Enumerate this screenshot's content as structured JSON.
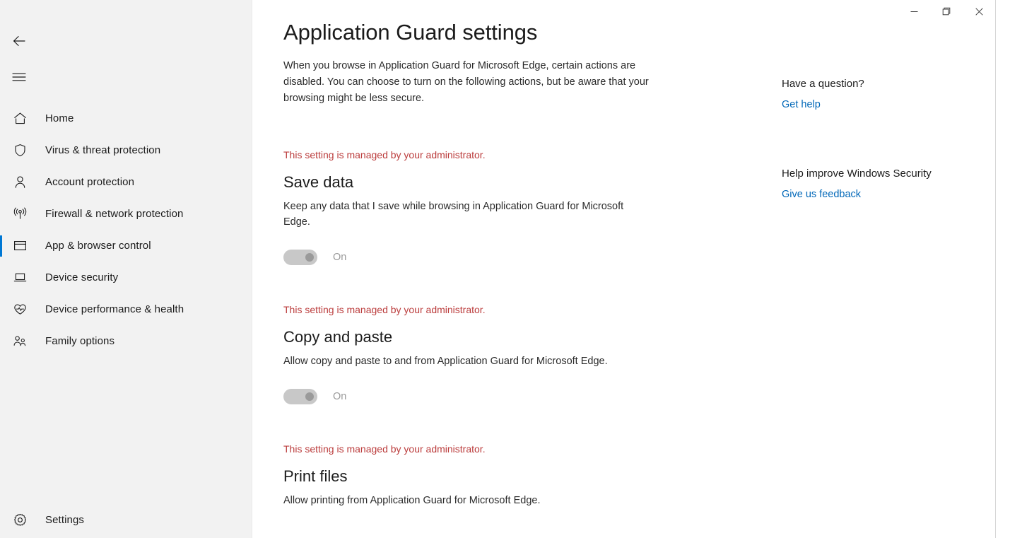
{
  "window": {
    "controls": [
      {
        "name": "minimize",
        "glyph": "minimize-icon",
        "label": "Minimize"
      },
      {
        "name": "restore",
        "glyph": "restore-icon",
        "label": "Restore Down"
      },
      {
        "name": "close",
        "glyph": "close-icon",
        "label": "Close"
      }
    ]
  },
  "sidebar": {
    "back_label": "Back",
    "menu_label": "Open Navigation",
    "items": [
      {
        "label": "Home",
        "icon": "home-icon",
        "active": false
      },
      {
        "label": "Virus & threat protection",
        "icon": "shield-icon",
        "active": false
      },
      {
        "label": "Account protection",
        "icon": "person-icon",
        "active": false
      },
      {
        "label": "Firewall & network protection",
        "icon": "signal-icon",
        "active": false
      },
      {
        "label": "App & browser control",
        "icon": "window-icon",
        "active": true
      },
      {
        "label": "Device security",
        "icon": "laptop-icon",
        "active": false
      },
      {
        "label": "Device performance & health",
        "icon": "heartbeat-icon",
        "active": false
      },
      {
        "label": "Family options",
        "icon": "family-icon",
        "active": false
      }
    ],
    "settings": {
      "label": "Settings",
      "icon": "gear-icon"
    }
  },
  "page": {
    "title": "Application Guard settings",
    "description": "When you browse in Application Guard for Microsoft Edge, certain actions are disabled. You can choose to turn on the following actions, but be aware that your browsing might be less secure."
  },
  "settings_sections": [
    {
      "admin_note": "This setting is managed by your administrator.",
      "title": "Save data",
      "description": "Keep any data that I save while browsing in Application Guard for Microsoft Edge.",
      "toggle_state": "On",
      "toggle_name": "save-data-toggle"
    },
    {
      "admin_note": "This setting is managed by your administrator.",
      "title": "Copy and paste",
      "description": "Allow copy and paste to and from Application Guard for Microsoft Edge.",
      "toggle_state": "On",
      "toggle_name": "copy-and-paste-toggle"
    },
    {
      "admin_note": "This setting is managed by your administrator.",
      "title": "Print files",
      "description": "Allow printing from Application Guard for Microsoft Edge.",
      "toggle_state": "",
      "toggle_name": "print-files-toggle"
    }
  ],
  "help": {
    "groups": [
      {
        "heading": "Have a question?",
        "link": "Get help"
      },
      {
        "heading": "Help improve Windows Security",
        "link": "Give us feedback"
      }
    ]
  },
  "colors": {
    "accent": "#0078d4",
    "link": "#0067b8",
    "warning": "#bb3c3c",
    "sidebar_bg": "#f2f2f2",
    "content_bg": "#ffffff",
    "toggle_track": "#c8c8c8",
    "toggle_knob": "#9a9a9a"
  }
}
